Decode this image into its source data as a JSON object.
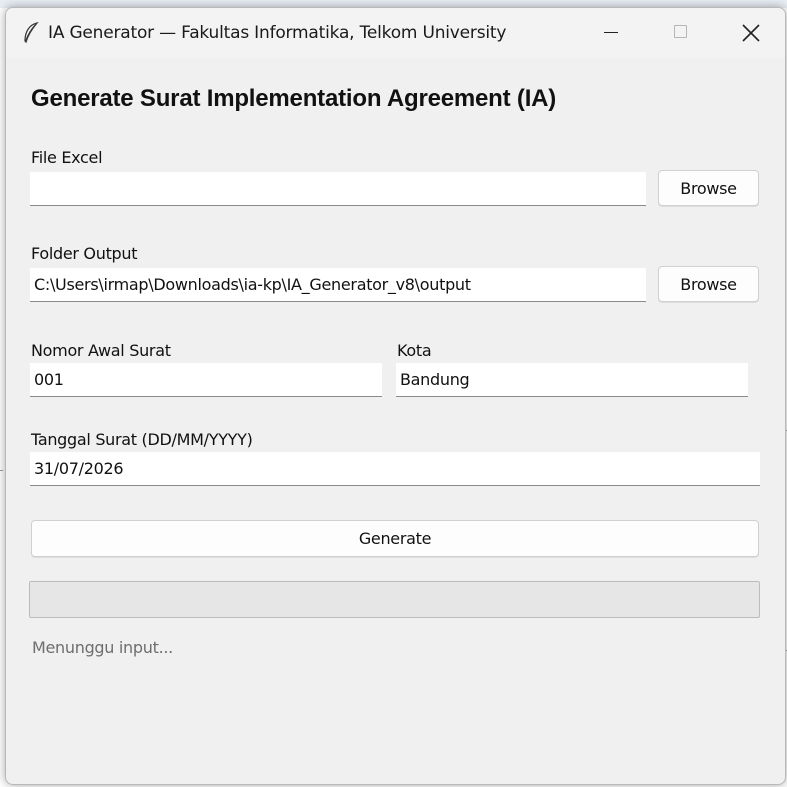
{
  "window": {
    "title": "IA Generator — Fakultas Informatika, Telkom University"
  },
  "form": {
    "heading": "Generate Surat Implementation Agreement (IA)",
    "file_excel": {
      "label": "File Excel",
      "value": "",
      "browse_label": "Browse"
    },
    "folder_output": {
      "label": "Folder Output",
      "value": "C:\\Users\\irmap\\Downloads\\ia-kp\\IA_Generator_v8\\output",
      "browse_label": "Browse"
    },
    "nomor_awal": {
      "label": "Nomor Awal Surat",
      "value": "001"
    },
    "kota": {
      "label": "Kota",
      "value": "Bandung"
    },
    "tanggal": {
      "label": "Tanggal Surat (DD/MM/YYYY)",
      "value": "31/07/2026"
    },
    "generate_label": "Generate",
    "progress_percent": 0,
    "status": "Menunggu input..."
  },
  "icons": {
    "app": "feather-icon",
    "minimize": "minimize-icon",
    "maximize": "maximize-icon",
    "close": "close-icon"
  }
}
